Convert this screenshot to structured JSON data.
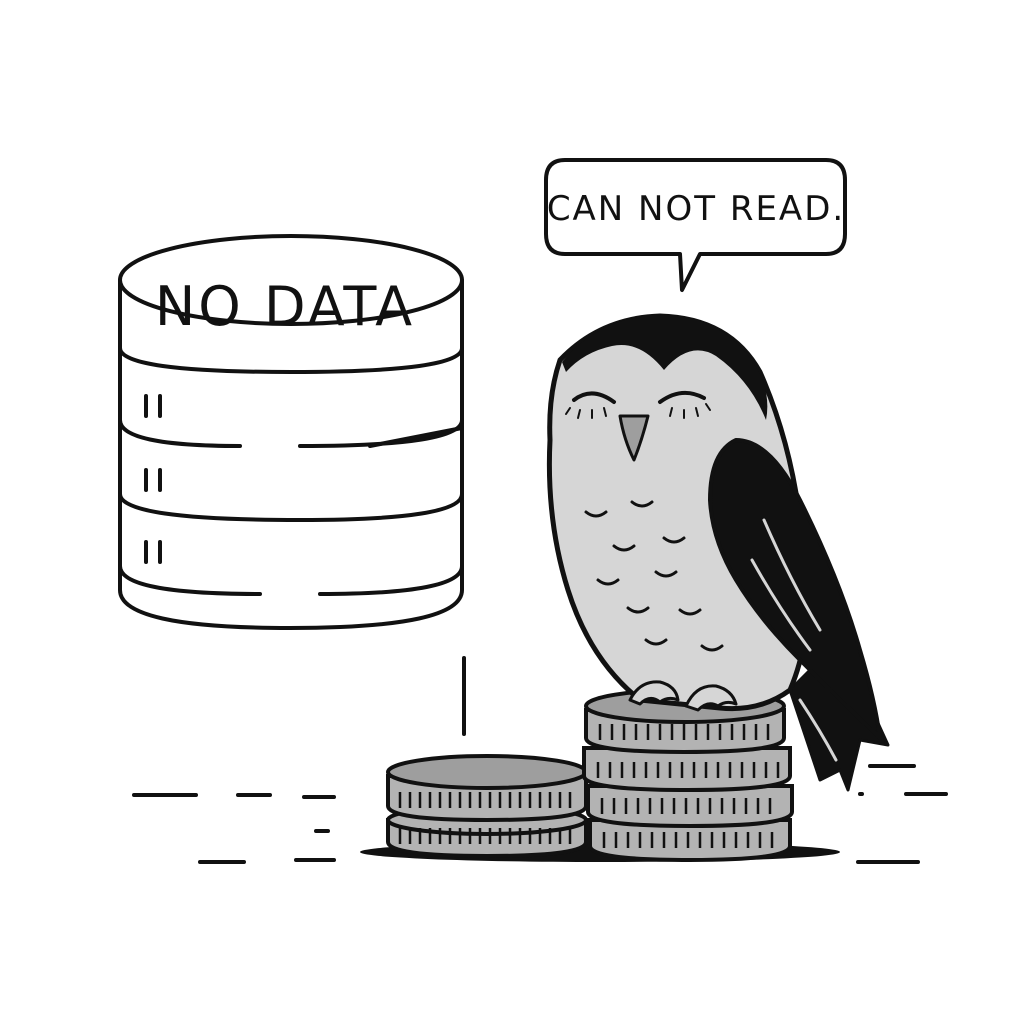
{
  "database": {
    "label": "NO DATA"
  },
  "speech_bubble": {
    "text": "CAN NOT READ."
  },
  "colors": {
    "ink": "#111111",
    "owl_body": "#d6d6d6",
    "coin_fill": "#b3b3b3",
    "coin_top": "#9e9e9e",
    "background": "#ffffff"
  }
}
